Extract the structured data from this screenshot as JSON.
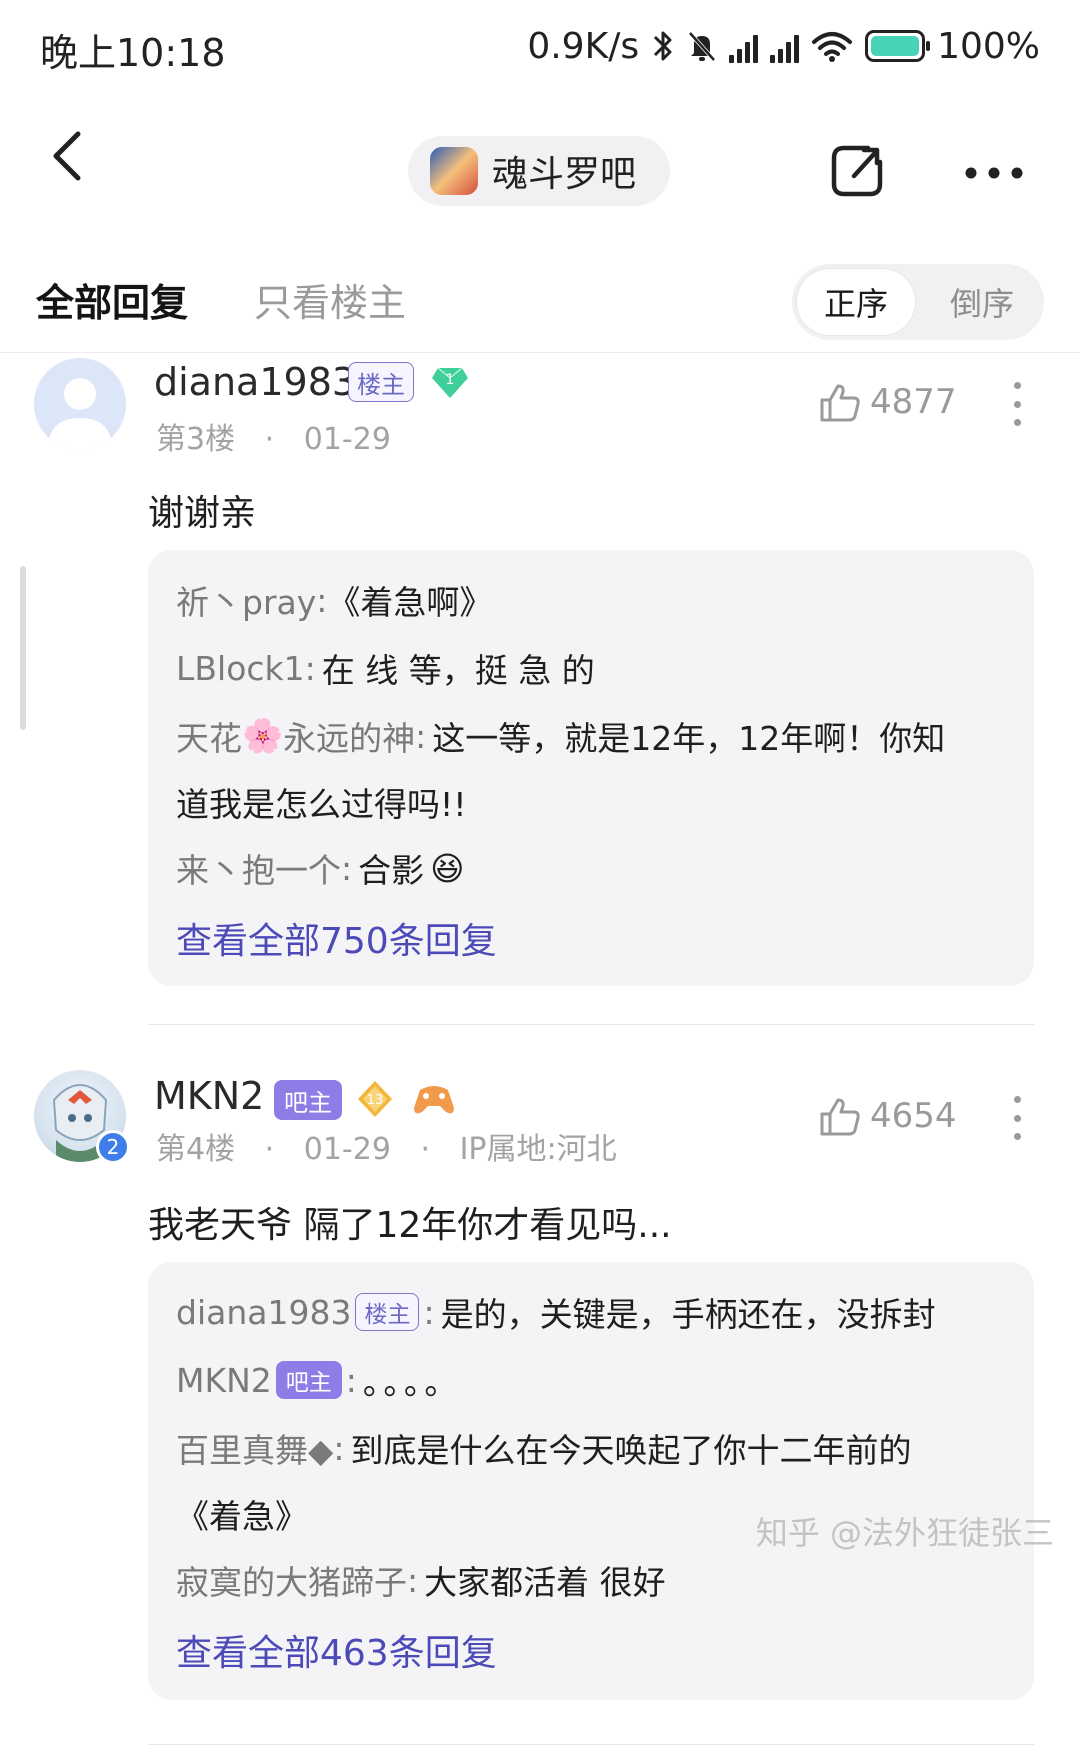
{
  "status_bar": {
    "time": "晚上10:18",
    "speed": "0.9K/s",
    "battery": "100%",
    "battery_level": 1.0,
    "icons": [
      "bluetooth-icon",
      "mute-icon",
      "signal-icon",
      "signal-icon",
      "wifi-icon",
      "battery-icon"
    ]
  },
  "header": {
    "bar_name": "魂斗罗吧",
    "icons": [
      "back-icon",
      "share-icon",
      "more-icon"
    ]
  },
  "tabs": {
    "all": "全部回复",
    "owner_only": "只看楼主",
    "order_asc": "正序",
    "order_desc": "倒序"
  },
  "posts": [
    {
      "user": "diana1983",
      "badge": "楼主",
      "level": "1",
      "floor": "第3楼",
      "sep": "·",
      "date": "01-29",
      "likes": "4877",
      "content": "谢谢亲",
      "replies": [
        {
          "user": "祈丶pray",
          "colon": ":",
          "text": "《着急啊》"
        },
        {
          "user": "LBlock1",
          "colon": ":",
          "text": "在 线 等，挺 急 的"
        },
        {
          "user": "天花",
          "user_suffix": "永远的神",
          "colon": ":",
          "text": "这一等，就是12年，12年啊！你知",
          "text2": "道我是怎么过得吗!!",
          "emoji": "🌸"
        },
        {
          "user": "来丶抱一个",
          "colon": ":",
          "text": "合影",
          "emoji": "😆"
        }
      ],
      "view_all": "查看全部750条回复"
    },
    {
      "user": "MKN2",
      "badge": "吧主",
      "level": "13",
      "avatar_badge": "2",
      "floor": "第4楼",
      "sep": "·",
      "date": "01-29",
      "ip": "IP属地:河北",
      "likes": "4654",
      "content": "我老天爷 隔了12年你才看见吗...",
      "replies": [
        {
          "user": "diana1983",
          "badge": "楼主",
          "colon": ":",
          "text": "是的，关键是，手柄还在，没拆封"
        },
        {
          "user": "MKN2",
          "badge": "吧主",
          "colon": ":",
          "text": "。。。。"
        },
        {
          "user": "百里真舞◆",
          "colon": ":",
          "text": "到底是什么在今天唤起了你十二年前的",
          "text2": "《着急》"
        },
        {
          "user": "寂寞的大猪蹄子",
          "colon": ":",
          "text": "大家都活着 很好"
        }
      ],
      "view_all": "查看全部463条回复"
    }
  ],
  "watermark": "知乎 @法外狂徒张三",
  "colors": {
    "accent": "#4c4ab8",
    "owner_badge": "#6d6ac4",
    "admin_badge": "#8f7ce6",
    "level_gem": "#3ecf9a",
    "level_gold": "#f4b63a"
  }
}
